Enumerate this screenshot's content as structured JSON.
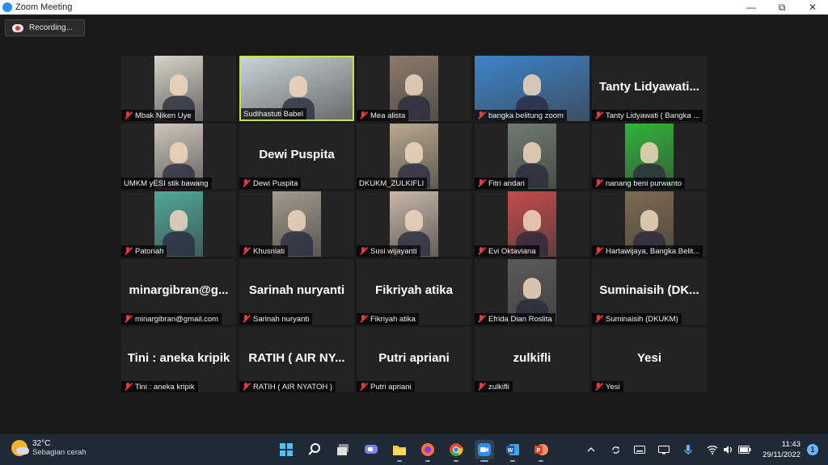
{
  "window": {
    "title": "Zoom Meeting",
    "minimize": "—",
    "restore": "⧉",
    "close": "✕"
  },
  "recording": {
    "label": "Recording..."
  },
  "colors": {
    "active_speaker": "#c8e04a",
    "mute": "#e23b3b",
    "taskbar": "#1f2a36"
  },
  "participants": [
    {
      "name": "Mbak Niken Uye",
      "big": "",
      "video": true,
      "muted": true,
      "photo": "#d6d3c8"
    },
    {
      "name": "Sudihastuti Babel",
      "big": "",
      "video": true,
      "muted": false,
      "active": true,
      "photo": "#c9d4d6"
    },
    {
      "name": "Mea alista",
      "big": "",
      "video": true,
      "muted": true,
      "photo": "#8c7b6b"
    },
    {
      "name": "bangka belitung zoom",
      "big": "",
      "video": true,
      "muted": true,
      "photo": "#3d83c9"
    },
    {
      "name": "Tanty Lidyawati ( Bangka ...",
      "big": "Tanty  Lidyawati...",
      "video": false,
      "muted": true
    },
    {
      "name": "UMKM yESI stik bawang",
      "big": "",
      "video": true,
      "muted": false,
      "photo": "#cfc6bd"
    },
    {
      "name": "Dewi Puspita",
      "big": "Dewi Puspita",
      "video": false,
      "muted": true
    },
    {
      "name": "DKUKM_ZULKIFLI",
      "big": "",
      "video": true,
      "muted": false,
      "photo": "#b9a98f"
    },
    {
      "name": "Fitri andari",
      "big": "",
      "video": true,
      "muted": true,
      "photo": "#6e7a72"
    },
    {
      "name": "nanang beni purwanto",
      "big": "",
      "video": true,
      "muted": true,
      "photo": "#2fb43a"
    },
    {
      "name": "Patonah",
      "big": "",
      "video": true,
      "muted": true,
      "photo": "#4fa89a"
    },
    {
      "name": "Khusniati",
      "big": "",
      "video": true,
      "muted": true,
      "photo": "#a39a8c"
    },
    {
      "name": "Susi wijayanti",
      "big": "",
      "video": true,
      "muted": true,
      "photo": "#c7b7a8"
    },
    {
      "name": "Evi Oktaviana",
      "big": "",
      "video": true,
      "muted": true,
      "photo": "#c34a4a"
    },
    {
      "name": "Hartawijaya, Bangka Belit...",
      "big": "",
      "video": true,
      "muted": true,
      "photo": "#7d6a52"
    },
    {
      "name": "minargibran@gmail.com",
      "big": "minargibran@g...",
      "video": false,
      "muted": true
    },
    {
      "name": "Sarinah nuryanti",
      "big": "Sarinah nuryanti",
      "video": false,
      "muted": true
    },
    {
      "name": "Fikriyah atika",
      "big": "Fikriyah atika",
      "video": false,
      "muted": true
    },
    {
      "name": "Efrida Dian Roslita",
      "big": "",
      "video": true,
      "muted": true,
      "photo": "#5a5a5a"
    },
    {
      "name": "Suminaisih (DKUKM)",
      "big": "Suminaisih  (DK...",
      "video": false,
      "muted": true
    },
    {
      "name": "Tini : aneka kripik",
      "big": "Tini : aneka kripik",
      "video": false,
      "muted": true
    },
    {
      "name": "RATIH  ( AIR NYATOH )",
      "big": "RATIH   ( AIR NY...",
      "video": false,
      "muted": true
    },
    {
      "name": "Putri apriani",
      "big": "Putri apriani",
      "video": false,
      "muted": true
    },
    {
      "name": "zulkifli",
      "big": "zulkifli",
      "video": false,
      "muted": true
    },
    {
      "name": "Yesi",
      "big": "Yesi",
      "video": false,
      "muted": true
    }
  ],
  "taskbar": {
    "weather": {
      "temp": "32°C",
      "condition": "Sebagian cerah"
    },
    "apps": [
      {
        "icon": "windows-start-icon",
        "color": "#4cc2ff"
      },
      {
        "icon": "search-icon",
        "color": "#ffffff"
      },
      {
        "icon": "task-view-icon",
        "color": "#e0e0e0"
      },
      {
        "icon": "chat-icon",
        "color": "#7b83eb"
      },
      {
        "icon": "file-explorer-icon",
        "color": "#f7c843"
      },
      {
        "icon": "firefox-icon",
        "color": "#ff7139"
      },
      {
        "icon": "chrome-icon",
        "color": "#34a853"
      },
      {
        "icon": "zoom-icon",
        "color": "#2d8cff",
        "active": true
      },
      {
        "icon": "word-icon",
        "color": "#2b579a"
      },
      {
        "icon": "powerpoint-icon",
        "color": "#d24726"
      }
    ],
    "time": "11:43",
    "date": "29/11/2022",
    "notifications": "1"
  }
}
